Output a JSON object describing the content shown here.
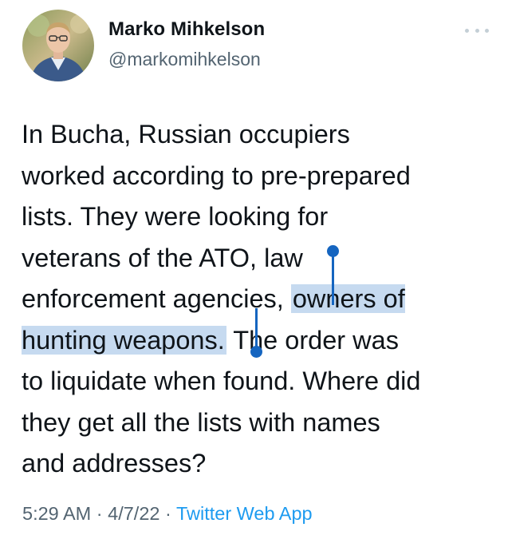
{
  "author": {
    "name": "Marko Mihkelson",
    "handle": "@markomihkelson",
    "avatar_icon": "profile-photo"
  },
  "tweet": {
    "lines": [
      "In Bucha, Russian occupiers",
      "worked according to pre-prepared",
      "lists. They were looking for",
      "veterans of the ATO, law",
      "enforcement agencies, ",
      "owners of",
      "hunting weapons.",
      " The order was",
      "to liquidate when found. Where did",
      "they get all the lists with names",
      "and addresses?"
    ],
    "selected_text": "owners of hunting weapons."
  },
  "footer": {
    "time": "5:29 AM",
    "separator": "·",
    "date": "4/7/22",
    "source": "Twitter Web App"
  },
  "colors": {
    "text": "#0f1419",
    "secondary": "#536471",
    "link": "#1d9bf0",
    "selection": "#c6daf0",
    "selection_handle": "#1565c0"
  },
  "more_icon": "more-dots-icon"
}
